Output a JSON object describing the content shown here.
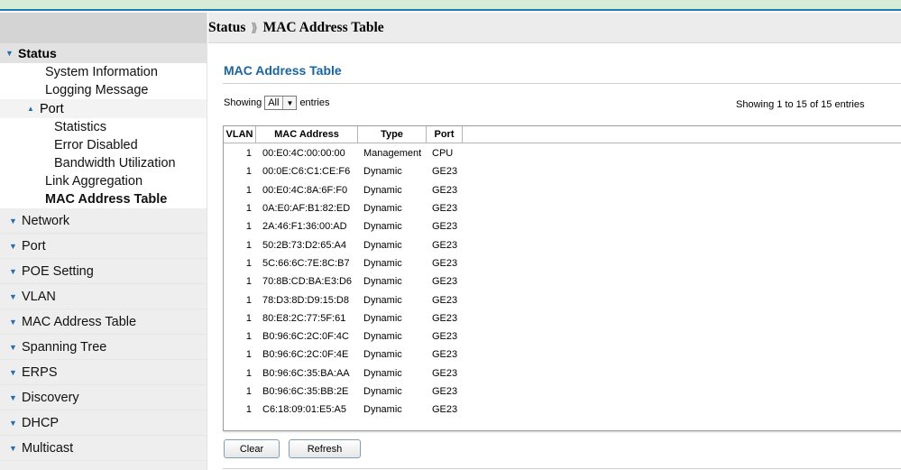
{
  "breadcrumb": {
    "section": "Status",
    "separator": "⟫",
    "page": "MAC Address Table"
  },
  "sidebar": {
    "status": {
      "label": "Status",
      "items": {
        "system_information": "System Information",
        "logging_message": "Logging Message",
        "port": {
          "label": "Port",
          "items": [
            "Statistics",
            "Error Disabled",
            "Bandwidth Utilization"
          ]
        },
        "link_aggregation": "Link Aggregation",
        "mac_address_table": "MAC Address Table"
      }
    },
    "groups": [
      "Network",
      "Port",
      "POE Setting",
      "VLAN",
      "MAC Address Table",
      "Spanning Tree",
      "ERPS",
      "Discovery",
      "DHCP",
      "Multicast"
    ]
  },
  "content": {
    "title": "MAC Address Table",
    "showing_prefix": "Showing",
    "entries_select": "All",
    "showing_suffix": "entries",
    "count_info": "Showing 1 to 15 of 15 entries",
    "columns": {
      "vlan": "VLAN",
      "mac": "MAC Address",
      "type": "Type",
      "port": "Port"
    },
    "rows": [
      {
        "vlan": "1",
        "mac": "00:E0:4C:00:00:00",
        "type": "Management",
        "port": "CPU"
      },
      {
        "vlan": "1",
        "mac": "00:0E:C6:C1:CE:F6",
        "type": "Dynamic",
        "port": "GE23"
      },
      {
        "vlan": "1",
        "mac": "00:E0:4C:8A:6F:F0",
        "type": "Dynamic",
        "port": "GE23"
      },
      {
        "vlan": "1",
        "mac": "0A:E0:AF:B1:82:ED",
        "type": "Dynamic",
        "port": "GE23"
      },
      {
        "vlan": "1",
        "mac": "2A:46:F1:36:00:AD",
        "type": "Dynamic",
        "port": "GE23"
      },
      {
        "vlan": "1",
        "mac": "50:2B:73:D2:65:A4",
        "type": "Dynamic",
        "port": "GE23"
      },
      {
        "vlan": "1",
        "mac": "5C:66:6C:7E:8C:B7",
        "type": "Dynamic",
        "port": "GE23"
      },
      {
        "vlan": "1",
        "mac": "70:8B:CD:BA:E3:D6",
        "type": "Dynamic",
        "port": "GE23"
      },
      {
        "vlan": "1",
        "mac": "78:D3:8D:D9:15:D8",
        "type": "Dynamic",
        "port": "GE23"
      },
      {
        "vlan": "1",
        "mac": "80:E8:2C:77:5F:61",
        "type": "Dynamic",
        "port": "GE23"
      },
      {
        "vlan": "1",
        "mac": "B0:96:6C:2C:0F:4C",
        "type": "Dynamic",
        "port": "GE23"
      },
      {
        "vlan": "1",
        "mac": "B0:96:6C:2C:0F:4E",
        "type": "Dynamic",
        "port": "GE23"
      },
      {
        "vlan": "1",
        "mac": "B0:96:6C:35:BA:AA",
        "type": "Dynamic",
        "port": "GE23"
      },
      {
        "vlan": "1",
        "mac": "B0:96:6C:35:BB:2E",
        "type": "Dynamic",
        "port": "GE23"
      },
      {
        "vlan": "1",
        "mac": "C6:18:09:01:E5:A5",
        "type": "Dynamic",
        "port": "GE23"
      }
    ],
    "buttons": {
      "clear": "Clear",
      "refresh": "Refresh"
    }
  },
  "colors": {
    "accent_blue": "#1565a8",
    "top_bar": "#1f7ab8"
  }
}
